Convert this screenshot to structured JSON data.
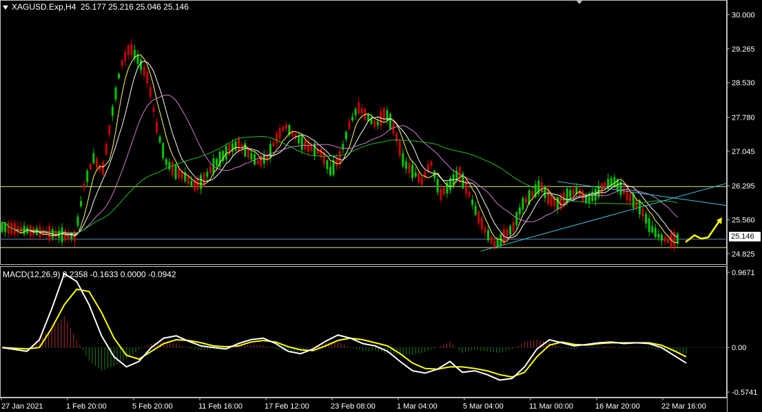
{
  "header": {
    "symbol": "XAGUSD.Exp,H4",
    "ohlc": "25.177 25.216 25.046 25.146"
  },
  "macd_header": {
    "label": "MACD(12,26,9)",
    "values": "0.2358 -0.1633 0.0000 -0.0942"
  },
  "current_price": "25.146",
  "colors": {
    "background": "#000000",
    "bull": "#00c800",
    "bear": "#c80000",
    "ma_fast": "#ffff66",
    "ma_mid": "#ffffff",
    "ma_slow": "#d080d0",
    "ma_long": "#22c022",
    "trendline": "#40c8e0",
    "hline": "#e8e890",
    "arrow": "#ffff00",
    "macd_line": "#ffffff",
    "signal_line": "#ffff00"
  },
  "chart_data": [
    {
      "type": "candlestick",
      "title": "XAGUSD.Exp,H4",
      "ylim": [
        24.6,
        30.2
      ],
      "y_ticks": [
        "30.000",
        "29.265",
        "28.530",
        "27.780",
        "27.045",
        "26.295",
        "25.560",
        "24.825"
      ],
      "x_ticks": [
        "27 Jan 2021",
        "1 Feb 20:00",
        "5 Feb 20:00",
        "11 Feb 16:00",
        "17 Feb 12:00",
        "23 Feb 08:00",
        "1 Mar 04:00",
        "5 Mar 04:00",
        "11 Mar 00:00",
        "16 Mar 20:00",
        "22 Mar 16:00"
      ],
      "path_close": [
        [
          0,
          25.4
        ],
        [
          4,
          25.35
        ],
        [
          8,
          25.3
        ],
        [
          12,
          25.25
        ],
        [
          16,
          25.2
        ],
        [
          18,
          26.3
        ],
        [
          20,
          26.9
        ],
        [
          22,
          26.6
        ],
        [
          24,
          27.8
        ],
        [
          26,
          28.9
        ],
        [
          28,
          29.3
        ],
        [
          30,
          29.0
        ],
        [
          32,
          28.6
        ],
        [
          34,
          27.5
        ],
        [
          36,
          26.8
        ],
        [
          38,
          26.6
        ],
        [
          40,
          26.5
        ],
        [
          42,
          26.3
        ],
        [
          44,
          26.4
        ],
        [
          46,
          26.7
        ],
        [
          48,
          26.9
        ],
        [
          50,
          27.1
        ],
        [
          52,
          27.2
        ],
        [
          54,
          27.0
        ],
        [
          56,
          26.8
        ],
        [
          58,
          26.9
        ],
        [
          60,
          27.3
        ],
        [
          62,
          27.6
        ],
        [
          64,
          27.4
        ],
        [
          66,
          27.2
        ],
        [
          68,
          27.1
        ],
        [
          70,
          27.0
        ],
        [
          72,
          26.6
        ],
        [
          74,
          26.9
        ],
        [
          76,
          27.6
        ],
        [
          78,
          28.0
        ],
        [
          80,
          27.8
        ],
        [
          82,
          27.6
        ],
        [
          84,
          27.9
        ],
        [
          86,
          27.5
        ],
        [
          88,
          26.8
        ],
        [
          90,
          26.6
        ],
        [
          92,
          26.4
        ],
        [
          94,
          26.8
        ],
        [
          96,
          26.1
        ],
        [
          98,
          26.3
        ],
        [
          100,
          26.6
        ],
        [
          102,
          26.2
        ],
        [
          104,
          25.7
        ],
        [
          106,
          25.3
        ],
        [
          108,
          25.0
        ],
        [
          110,
          25.2
        ],
        [
          112,
          25.4
        ],
        [
          114,
          25.9
        ],
        [
          116,
          26.1
        ],
        [
          118,
          26.3
        ],
        [
          120,
          26.0
        ],
        [
          122,
          25.9
        ],
        [
          124,
          26.1
        ],
        [
          126,
          26.2
        ],
        [
          128,
          26.0
        ],
        [
          130,
          26.1
        ],
        [
          132,
          26.3
        ],
        [
          134,
          26.4
        ],
        [
          136,
          26.2
        ],
        [
          138,
          26.0
        ],
        [
          140,
          25.8
        ],
        [
          142,
          25.4
        ],
        [
          144,
          25.2
        ],
        [
          146,
          25.1
        ],
        [
          148,
          25.15
        ]
      ],
      "horizontal_lines": [
        26.28,
        25.14,
        24.96
      ],
      "trendlines": [
        {
          "from": [
            100,
            24.88
          ],
          "to": [
            150,
            26.35
          ]
        },
        {
          "from": [
            116,
            26.39
          ],
          "to": [
            150,
            25.87
          ]
        }
      ]
    },
    {
      "type": "macd",
      "title": "MACD(12,26,9)",
      "ylim": [
        -0.5741,
        0.9671
      ],
      "y_ticks": [
        "0.9671",
        "0.00",
        "-0.5741"
      ],
      "macd": [
        [
          0,
          0.0
        ],
        [
          4,
          -0.05
        ],
        [
          6,
          0.1
        ],
        [
          8,
          0.5
        ],
        [
          10,
          0.95
        ],
        [
          12,
          0.85
        ],
        [
          14,
          0.55
        ],
        [
          16,
          0.15
        ],
        [
          18,
          -0.12
        ],
        [
          20,
          -0.25
        ],
        [
          22,
          -0.18
        ],
        [
          24,
          0.0
        ],
        [
          26,
          0.12
        ],
        [
          28,
          0.15
        ],
        [
          30,
          0.08
        ],
        [
          32,
          0.02
        ],
        [
          34,
          0.0
        ],
        [
          36,
          -0.02
        ],
        [
          38,
          0.05
        ],
        [
          40,
          0.1
        ],
        [
          42,
          0.12
        ],
        [
          44,
          0.05
        ],
        [
          46,
          -0.05
        ],
        [
          48,
          -0.08
        ],
        [
          50,
          -0.02
        ],
        [
          52,
          0.08
        ],
        [
          54,
          0.16
        ],
        [
          56,
          0.12
        ],
        [
          58,
          0.05
        ],
        [
          60,
          0.02
        ],
        [
          62,
          -0.05
        ],
        [
          64,
          -0.18
        ],
        [
          66,
          -0.3
        ],
        [
          68,
          -0.33
        ],
        [
          70,
          -0.28
        ],
        [
          72,
          -0.18
        ],
        [
          74,
          -0.32
        ],
        [
          76,
          -0.3
        ],
        [
          78,
          -0.35
        ],
        [
          80,
          -0.42
        ],
        [
          82,
          -0.4
        ],
        [
          84,
          -0.25
        ],
        [
          86,
          -0.02
        ],
        [
          88,
          0.1
        ],
        [
          90,
          0.06
        ],
        [
          92,
          0.02
        ],
        [
          94,
          0.04
        ],
        [
          96,
          0.06
        ],
        [
          98,
          0.07
        ],
        [
          100,
          0.05
        ],
        [
          102,
          0.06
        ],
        [
          104,
          0.05
        ],
        [
          106,
          0.0
        ],
        [
          108,
          -0.1
        ],
        [
          110,
          -0.2
        ]
      ],
      "signal": [
        [
          0,
          0.0
        ],
        [
          4,
          -0.02
        ],
        [
          6,
          0.0
        ],
        [
          8,
          0.25
        ],
        [
          10,
          0.55
        ],
        [
          12,
          0.75
        ],
        [
          14,
          0.72
        ],
        [
          16,
          0.45
        ],
        [
          18,
          0.12
        ],
        [
          20,
          -0.1
        ],
        [
          22,
          -0.15
        ],
        [
          24,
          -0.05
        ],
        [
          26,
          0.05
        ],
        [
          28,
          0.1
        ],
        [
          30,
          0.09
        ],
        [
          32,
          0.06
        ],
        [
          34,
          0.02
        ],
        [
          36,
          0.01
        ],
        [
          38,
          0.02
        ],
        [
          40,
          0.07
        ],
        [
          42,
          0.09
        ],
        [
          44,
          0.07
        ],
        [
          46,
          0.01
        ],
        [
          48,
          -0.03
        ],
        [
          50,
          -0.04
        ],
        [
          52,
          0.02
        ],
        [
          54,
          0.09
        ],
        [
          56,
          0.12
        ],
        [
          58,
          0.1
        ],
        [
          60,
          0.06
        ],
        [
          62,
          0.02
        ],
        [
          64,
          -0.08
        ],
        [
          66,
          -0.2
        ],
        [
          68,
          -0.27
        ],
        [
          70,
          -0.28
        ],
        [
          72,
          -0.25
        ],
        [
          74,
          -0.25
        ],
        [
          76,
          -0.27
        ],
        [
          78,
          -0.3
        ],
        [
          80,
          -0.35
        ],
        [
          82,
          -0.38
        ],
        [
          84,
          -0.32
        ],
        [
          86,
          -0.12
        ],
        [
          88,
          0.03
        ],
        [
          90,
          0.07
        ],
        [
          92,
          0.04
        ],
        [
          94,
          0.03
        ],
        [
          96,
          0.05
        ],
        [
          98,
          0.06
        ],
        [
          100,
          0.06
        ],
        [
          102,
          0.06
        ],
        [
          104,
          0.06
        ],
        [
          106,
          0.03
        ],
        [
          108,
          -0.04
        ],
        [
          110,
          -0.12
        ]
      ]
    }
  ]
}
